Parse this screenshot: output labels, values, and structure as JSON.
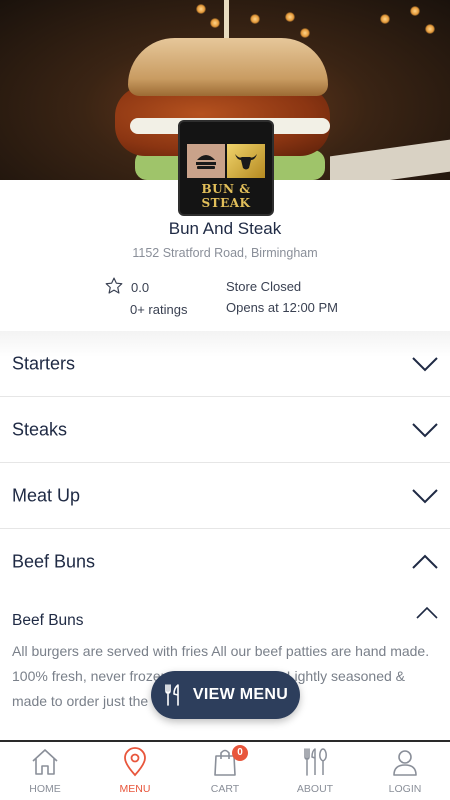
{
  "store": {
    "name": "Bun And Steak",
    "address": "1152 Stratford Road, Birmingham",
    "rating": "0.0",
    "ratings_count": "0+ ratings",
    "status": "Store Closed",
    "opens_at": "Opens at 12:00 PM",
    "logo_text": "BUN & STEAK"
  },
  "categories": [
    {
      "label": "Starters",
      "expanded": false
    },
    {
      "label": "Steaks",
      "expanded": false
    },
    {
      "label": "Meat Up",
      "expanded": false
    },
    {
      "label": "Beef Buns",
      "expanded": true
    }
  ],
  "subcategory": {
    "title": "Beef Buns",
    "description": "All burgers are served with fries All our beef patties are hand made. 100% fresh, never frozen, no preservatives. Lightly seasoned & made to order just the way they should be!"
  },
  "view_menu": {
    "label": "VIEW MENU",
    "icon": "cutlery-icon"
  },
  "nav": {
    "items": [
      {
        "label": "HOME",
        "icon": "home-icon",
        "active": false
      },
      {
        "label": "MENU",
        "icon": "location-pin-icon",
        "active": true
      },
      {
        "label": "CART",
        "icon": "shopping-bag-icon",
        "active": false
      },
      {
        "label": "ABOUT",
        "icon": "cutlery-icon",
        "active": false
      },
      {
        "label": "LOGIN",
        "icon": "user-icon",
        "active": false
      }
    ],
    "cart_count": "0"
  },
  "colors": {
    "accent": "#e8563c",
    "primary_dark": "#2d3e5c",
    "text_dark": "#1f2a44",
    "text_muted": "#8a8f99"
  }
}
